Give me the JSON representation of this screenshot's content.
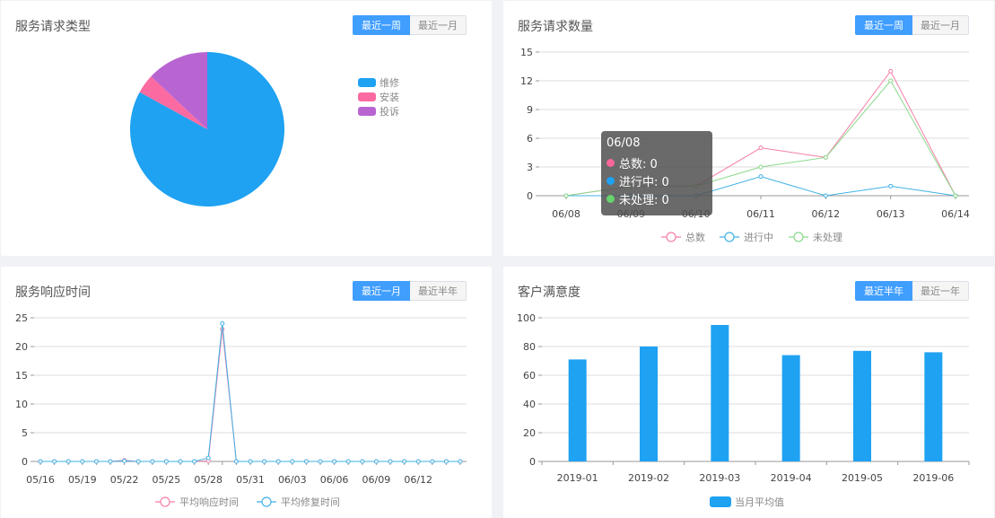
{
  "panels": {
    "service_type": {
      "title": "服务请求类型",
      "buttons": [
        "最近一周",
        "最近一月"
      ],
      "active": 0
    },
    "service_count": {
      "title": "服务请求数量",
      "buttons": [
        "最近一周",
        "最近一月"
      ],
      "active": 0
    },
    "response_time": {
      "title": "服务响应时间",
      "buttons": [
        "最近一月",
        "最近半年"
      ],
      "active": 0
    },
    "satisfaction": {
      "title": "客户满意度",
      "buttons": [
        "最近半年",
        "最近一年"
      ],
      "active": 0
    }
  },
  "tooltip": {
    "title": "06/08",
    "rows": [
      {
        "label": "总数: 0",
        "color": "#f7679b"
      },
      {
        "label": "进行中: 0",
        "color": "#1fa2f2"
      },
      {
        "label": "未处理: 0",
        "color": "#66d36e"
      }
    ]
  },
  "chart_data": [
    {
      "type": "pie",
      "categories": [
        "维修",
        "安装",
        "投诉"
      ],
      "values": [
        83,
        4,
        13
      ],
      "colors": [
        "#1fa2f2",
        "#fb6aa1",
        "#b865d2"
      ],
      "legend_position": "right"
    },
    {
      "type": "line",
      "categories": [
        "06/08",
        "06/09",
        "06/10",
        "06/11",
        "06/12",
        "06/13",
        "06/14"
      ],
      "series": [
        {
          "name": "总数",
          "values": [
            0,
            1,
            1,
            5,
            4,
            13,
            0
          ],
          "color": "#f57fa7"
        },
        {
          "name": "进行中",
          "values": [
            0,
            0,
            0,
            2,
            0,
            1,
            0
          ],
          "color": "#41b2e5"
        },
        {
          "name": "未处理",
          "values": [
            0,
            1,
            1,
            3,
            4,
            12,
            0
          ],
          "color": "#8ad98b"
        }
      ],
      "ylim": [
        0,
        15
      ],
      "yticks": [
        0,
        3,
        6,
        9,
        12,
        15
      ],
      "grid": true,
      "legend_position": "bottom"
    },
    {
      "type": "line",
      "categories": [
        "05/16",
        "05/17",
        "05/18",
        "05/19",
        "05/20",
        "05/21",
        "05/22",
        "05/23",
        "05/24",
        "05/25",
        "05/26",
        "05/27",
        "05/28",
        "05/29",
        "05/30",
        "05/31",
        "06/01",
        "06/02",
        "06/03",
        "06/04",
        "06/05",
        "06/06",
        "06/07",
        "06/08",
        "06/09",
        "06/10",
        "06/11",
        "06/12",
        "06/13",
        "06/14",
        "06/15"
      ],
      "xtick_labels": [
        "05/16",
        "05/19",
        "05/22",
        "05/25",
        "05/28",
        "05/31",
        "06/03",
        "06/06",
        "06/09",
        "06/12"
      ],
      "series": [
        {
          "name": "平均响应时间",
          "values": [
            0,
            0,
            0,
            0,
            0,
            0,
            0.2,
            0,
            0,
            0,
            0,
            0,
            0.1,
            23,
            0,
            0,
            0,
            0,
            0,
            0,
            0,
            0,
            0,
            0,
            0,
            0,
            0,
            0,
            0,
            0,
            0
          ],
          "color": "#f57fa7"
        },
        {
          "name": "平均修复时间",
          "values": [
            0,
            0,
            0,
            0,
            0,
            0,
            0.1,
            0,
            0,
            0,
            0,
            0,
            0.6,
            24,
            0,
            0,
            0,
            0,
            0,
            0,
            0,
            0,
            0,
            0,
            0,
            0,
            0,
            0,
            0,
            0,
            0
          ],
          "color": "#41b2e5"
        }
      ],
      "ylim": [
        0,
        25
      ],
      "yticks": [
        0,
        5,
        10,
        15,
        20,
        25
      ],
      "grid": true,
      "legend_position": "bottom"
    },
    {
      "type": "bar",
      "categories": [
        "2019-01",
        "2019-02",
        "2019-03",
        "2019-04",
        "2019-05",
        "2019-06"
      ],
      "series": [
        {
          "name": "当月平均值",
          "values": [
            71,
            80,
            95,
            74,
            77,
            76
          ],
          "color": "#1fa2f2"
        }
      ],
      "ylim": [
        0,
        100
      ],
      "yticks": [
        0,
        20,
        40,
        60,
        80,
        100
      ],
      "grid": true,
      "legend_position": "bottom"
    }
  ]
}
